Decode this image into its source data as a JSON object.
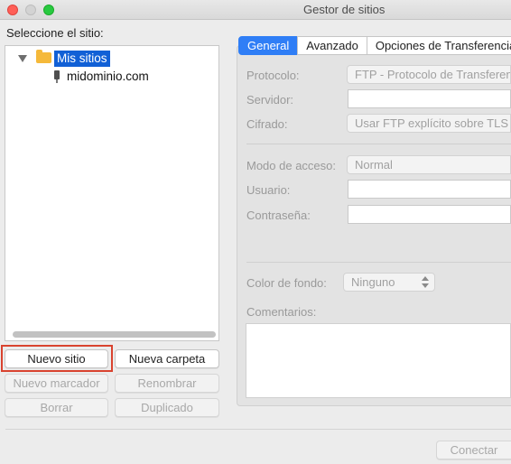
{
  "window": {
    "title": "Gestor de sitios"
  },
  "tree": {
    "label": "Seleccione el sitio:",
    "root": "Mis sitios",
    "site": "midominio.com"
  },
  "buttons": {
    "new_site": "Nuevo sitio",
    "new_folder": "Nueva carpeta",
    "new_bookmark": "Nuevo marcador",
    "rename": "Renombrar",
    "delete": "Borrar",
    "duplicate": "Duplicado",
    "connect": "Conectar"
  },
  "tabs": [
    "General",
    "Avanzado",
    "Opciones de Transferencia"
  ],
  "form": {
    "protocol_label": "Protocolo:",
    "protocol_value": "FTP - Protocolo de Transferencia de Archivos",
    "server_label": "Servidor:",
    "server_value": "",
    "encryption_label": "Cifrado:",
    "encryption_value": "Usar FTP explícito sobre TLS si está disponible",
    "access_label": "Modo de acceso:",
    "access_value": "Normal",
    "user_label": "Usuario:",
    "user_value": "",
    "password_label": "Contraseña:",
    "password_value": "",
    "bg_color_label": "Color de fondo:",
    "bg_color_value": "Ninguno",
    "comments_label": "Comentarios:",
    "comments_value": ""
  },
  "colors": {
    "accent": "#2f7ef6",
    "selection": "#1160d6",
    "highlight_border": "#d9432f",
    "folder": "#f5b93a"
  }
}
